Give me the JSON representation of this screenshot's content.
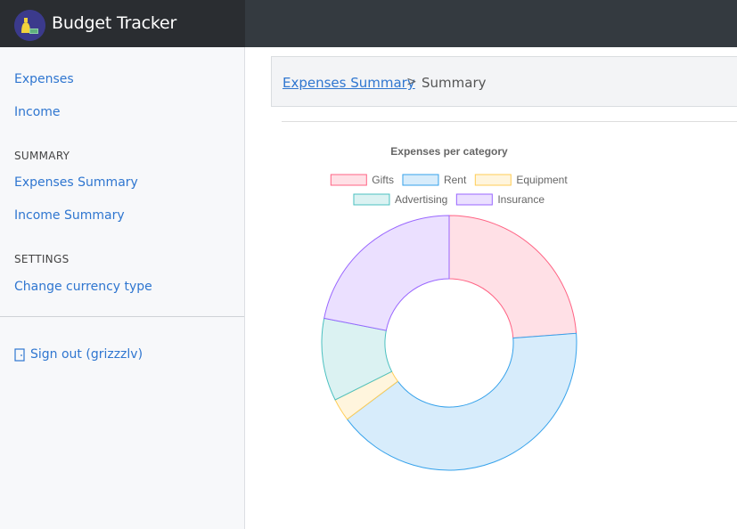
{
  "app": {
    "title": "Budget Tracker"
  },
  "sidebar": {
    "links": [
      "Expenses",
      "Income"
    ],
    "summary_heading": "SUMMARY",
    "summary_links": [
      "Expenses Summary",
      "Income Summary"
    ],
    "settings_heading": "SETTINGS",
    "settings_links": [
      "Change currency type"
    ],
    "signout": "Sign out (grizzzlv)"
  },
  "breadcrumb": {
    "parent": "Expenses Summary",
    "separator": ">",
    "current": "Summary"
  },
  "colors": {
    "topbar": "#343a40",
    "link": "#2f76d0"
  },
  "chart_data": {
    "type": "pie",
    "title": "Expenses per category",
    "labels": [
      "Gifts",
      "Rent",
      "Equipment",
      "Advertising",
      "Insurance"
    ],
    "values": [
      25,
      43,
      3,
      11,
      23
    ],
    "fills": [
      "#ffe0e6",
      "#d7ecfb",
      "#fff5dd",
      "#dbf2f2",
      "#ebe0ff"
    ],
    "borders": [
      "#ff6384",
      "#36a2eb",
      "#ffcd56",
      "#4bc0c0",
      "#9966ff"
    ],
    "legend_position": "top",
    "doughnut": true
  }
}
